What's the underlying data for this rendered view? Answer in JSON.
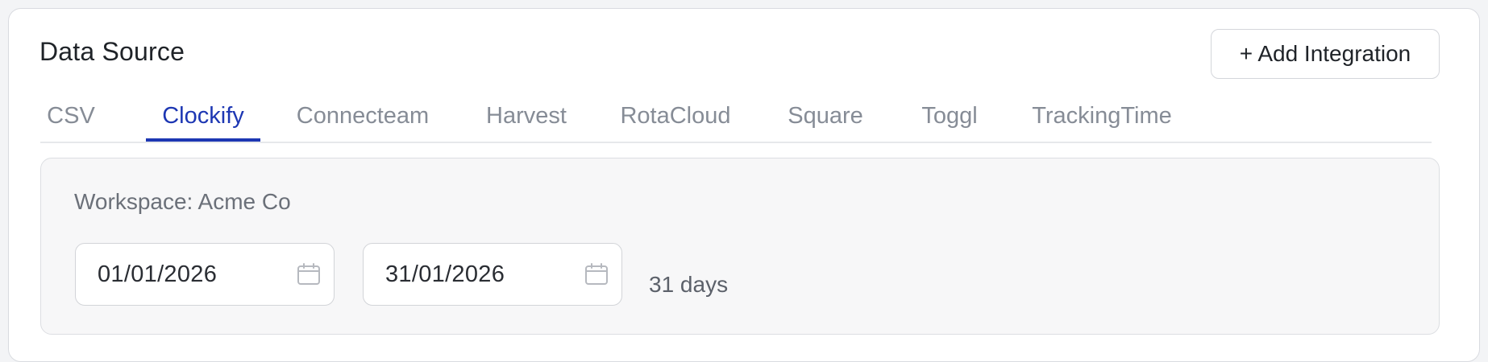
{
  "header": {
    "title": "Data Source",
    "add_button_label": "+ Add Integration"
  },
  "tabs": [
    {
      "label": "CSV",
      "active": false
    },
    {
      "label": "Clockify",
      "active": true
    },
    {
      "label": "Connecteam",
      "active": false
    },
    {
      "label": "Harvest",
      "active": false
    },
    {
      "label": "RotaCloud",
      "active": false
    },
    {
      "label": "Square",
      "active": false
    },
    {
      "label": "Toggl",
      "active": false
    },
    {
      "label": "TrackingTime",
      "active": false
    }
  ],
  "panel": {
    "workspace_label": "Workspace: Acme Co",
    "start_date": "01/01/2026",
    "end_date": "31/01/2026",
    "range_summary": "31 days",
    "date_icon": "calendar-icon"
  },
  "colors": {
    "accent": "#1d37b3",
    "tab_inactive": "#868c96",
    "panel_bg": "#f7f7f8"
  }
}
